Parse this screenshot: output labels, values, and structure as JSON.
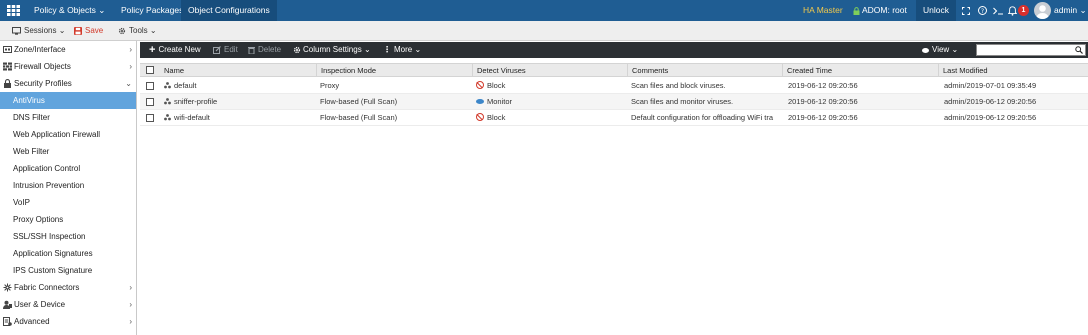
{
  "topbar": {
    "nav": [
      "Policy & Objects",
      "Policy Packages",
      "Object Configurations"
    ],
    "ha_status": "HA Master",
    "adom": "ADOM: root",
    "unlock_label": "Unlock",
    "notification_count": "1",
    "user": "admin",
    "colors": {
      "bar": "#1f5d93",
      "active": "#174d7c",
      "ha": "#f2c94c",
      "badge": "#d9302c"
    }
  },
  "toolbar": {
    "sessions_label": "Sessions",
    "save_label": "Save",
    "tools_label": "Tools"
  },
  "sidebar": {
    "items": [
      {
        "label": "Zone/Interface",
        "icon": "interface-icon",
        "level": "top",
        "chevron": ">"
      },
      {
        "label": "Firewall Objects",
        "icon": "firewall-icon",
        "level": "top",
        "chevron": ">"
      },
      {
        "label": "Security Profiles",
        "icon": "lock-icon",
        "level": "top",
        "chevron": "v"
      },
      {
        "label": "AntiVirus",
        "level": "sub",
        "active": true
      },
      {
        "label": "DNS Filter",
        "level": "sub"
      },
      {
        "label": "Web Application Firewall",
        "level": "sub"
      },
      {
        "label": "Web Filter",
        "level": "sub"
      },
      {
        "label": "Application Control",
        "level": "sub"
      },
      {
        "label": "Intrusion Prevention",
        "level": "sub"
      },
      {
        "label": "VoIP",
        "level": "sub"
      },
      {
        "label": "Proxy Options",
        "level": "sub"
      },
      {
        "label": "SSL/SSH Inspection",
        "level": "sub"
      },
      {
        "label": "Application Signatures",
        "level": "sub"
      },
      {
        "label": "IPS Custom Signature",
        "level": "sub"
      },
      {
        "label": "Fabric Connectors",
        "icon": "fabric-icon",
        "level": "top",
        "chevron": ">"
      },
      {
        "label": "User & Device",
        "icon": "user-icon",
        "level": "top",
        "chevron": ">"
      },
      {
        "label": "Advanced",
        "icon": "advanced-icon",
        "level": "top",
        "chevron": ">"
      }
    ]
  },
  "content_toolbar": {
    "create_new": "Create New",
    "edit": "Edit",
    "delete": "Delete",
    "column_settings": "Column Settings",
    "more": "More",
    "view": "View",
    "search_placeholder": ""
  },
  "table": {
    "columns": [
      "Name",
      "Inspection Mode",
      "Detect Viruses",
      "Comments",
      "Created Time",
      "Last Modified"
    ],
    "rows": [
      {
        "name": "default",
        "mode": "Proxy",
        "detect": "Block",
        "detect_icon": "block-icon",
        "comments": "Scan files and block viruses.",
        "created": "2019-06-12 09:20:56",
        "modified": "admin/2019-07-01 09:35:49"
      },
      {
        "name": "sniffer-profile",
        "mode": "Flow-based (Full Scan)",
        "detect": "Monitor",
        "detect_icon": "eye-icon",
        "comments": "Scan files and monitor viruses.",
        "created": "2019-06-12 09:20:56",
        "modified": "admin/2019-06-12 09:20:56"
      },
      {
        "name": "wifi-default",
        "mode": "Flow-based (Full Scan)",
        "detect": "Block",
        "detect_icon": "block-icon",
        "comments": "Default configuration for offloading WiFi tra",
        "created": "2019-06-12 09:20:56",
        "modified": "admin/2019-06-12 09:20:56"
      }
    ]
  }
}
